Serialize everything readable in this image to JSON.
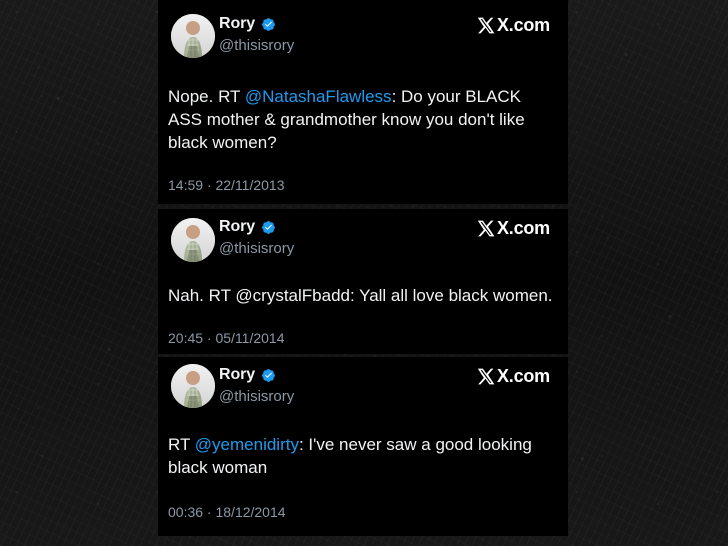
{
  "tweets": [
    {
      "name": "Rory",
      "handle": "@thisisrory",
      "source": "X.com",
      "text_prefix": "Nope. RT ",
      "mention": "@NatashaFlawless",
      "text_suffix": ": Do your BLACK ASS mother & grandmother know you don't like black women?",
      "timestamp": "14:59 · 22/11/2013"
    },
    {
      "name": "Rory",
      "handle": "@thisisrory",
      "source": "X.com",
      "text": "Nah. RT @crystalFbadd: Yall all love black women.",
      "timestamp": "20:45 · 05/11/2014"
    },
    {
      "name": "Rory",
      "handle": "@thisisrory",
      "source": "X.com",
      "text_prefix": "RT ",
      "mention": "@yemenidirty",
      "text_suffix": ": I've never saw a good looking black woman",
      "timestamp": "00:36 · 18/12/2014"
    }
  ],
  "icons": {
    "verified": "verified-badge-icon",
    "brand": "x-logo-icon"
  },
  "colors": {
    "card_background": "#000000",
    "mention_blue": "#1d9bf0",
    "muted_text": "#8b98a5",
    "verified_blue": "#1d9bf0"
  }
}
